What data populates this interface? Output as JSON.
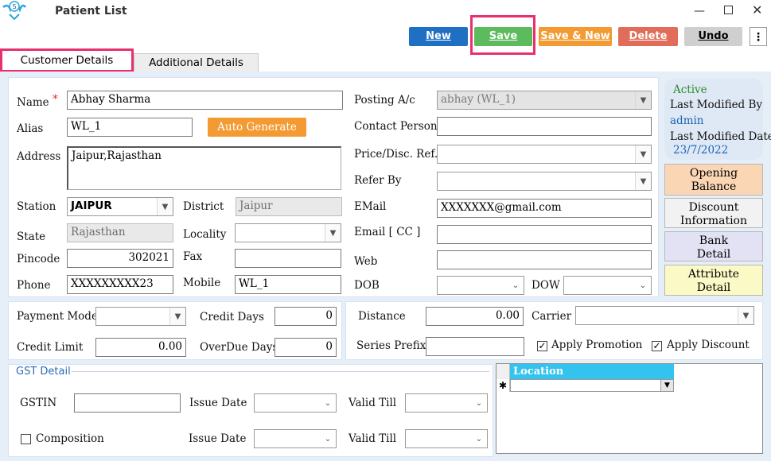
{
  "window": {
    "title": "Patient List"
  },
  "toolbar": {
    "new": "New",
    "save": "Save",
    "save_new": "Save & New",
    "delete": "Delete",
    "undo": "Undo",
    "more": "⋮"
  },
  "tabs": {
    "customer": "Customer Details",
    "additional": "Additional Details"
  },
  "form": {
    "name_label": "Name",
    "required_mark": "*",
    "name_value": "Abhay Sharma",
    "alias_label": "Alias",
    "alias_value": "WL_1",
    "auto_generate": "Auto Generate",
    "address_label": "Address",
    "address_value": "Jaipur,Rajasthan",
    "station_label": "Station",
    "station_value": "JAIPUR",
    "district_label": "District",
    "district_value": "Jaipur",
    "state_label": "State",
    "state_value": "Rajasthan",
    "locality_label": "Locality",
    "locality_value": "",
    "pincode_label": "Pincode",
    "pincode_value": "302021",
    "fax_label": "Fax",
    "fax_value": "",
    "phone_label": "Phone",
    "phone_value": "XXXXXXXXX23",
    "mobile_label": "Mobile",
    "mobile_value": "WL_1",
    "posting_label": "Posting A/c",
    "posting_value": "abhay (WL_1)",
    "contact_label": "Contact Person",
    "contact_value": "",
    "price_label": "Price/Disc. Ref.",
    "price_value": "",
    "refer_label": "Refer By",
    "refer_value": "",
    "email_label": "EMail",
    "email_value": "XXXXXXX@gmail.com",
    "emailcc_label": "Email [ CC ]",
    "emailcc_value": "",
    "web_label": "Web",
    "web_value": "",
    "dob_label": "DOB",
    "dob_value": "",
    "dow_label": "DOW",
    "dow_value": ""
  },
  "status": {
    "active": "Active",
    "modified_by_label": "Last Modified By",
    "modified_by": "admin",
    "modified_date_label": "Last Modified Date",
    "modified_date": "23/7/2022"
  },
  "side_buttons": {
    "opening": [
      "Opening",
      "Balance"
    ],
    "discount": [
      "Discount",
      "Information"
    ],
    "bank": [
      "Bank",
      "Detail"
    ],
    "attribute": [
      "Attribute",
      "Detail"
    ]
  },
  "payment": {
    "mode_label": "Payment Mode",
    "mode_value": "",
    "credit_days_label": "Credit Days",
    "credit_days_value": "0",
    "credit_limit_label": "Credit Limit",
    "credit_limit_value": "0.00",
    "overdue_label": "OverDue Days",
    "overdue_value": "0"
  },
  "misc": {
    "distance_label": "Distance",
    "distance_value": "0.00",
    "carrier_label": "Carrier",
    "carrier_value": "",
    "series_label": "Series Prefix",
    "series_value": "",
    "apply_promotion": "Apply Promotion",
    "apply_discount": "Apply Discount"
  },
  "gst": {
    "legend": "GST Detail",
    "gstin_label": "GSTIN",
    "gstin_value": "",
    "issue_date_label": "Issue Date",
    "valid_till_label": "Valid Till",
    "composition": "Composition"
  },
  "location": {
    "header": "Location",
    "row_marker": "✱"
  },
  "colors": {
    "new": "#1f6fc2",
    "save": "#5cbb5c",
    "save_new": "#f39a32",
    "delete": "#e16c5a",
    "undo": "#cfcfcf",
    "highlight": "#e8306e",
    "location_header": "#33c3ef",
    "opening": "#fbd6b4",
    "discount": "#f2f2f2",
    "bank": "#e2e2f4",
    "attribute": "#fbfac6"
  }
}
